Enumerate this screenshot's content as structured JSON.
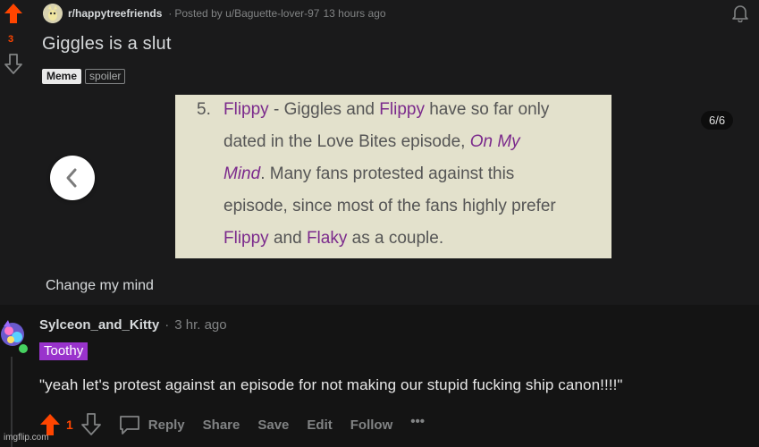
{
  "post": {
    "score": "3",
    "subreddit": "r/happytreefriends",
    "posted_by": "Posted by u/Baguette-lover-97",
    "time": "13 hours ago",
    "title": "Giggles is a slut",
    "flairs": [
      "Meme",
      "spoiler"
    ],
    "caption": "Change my mind",
    "gallery_counter": "6/6",
    "image_text": {
      "number": "5.",
      "line1": [
        "Flippy",
        " - Giggles and ",
        "Flippy",
        " have so far only"
      ],
      "line2": [
        "dated in the Love Bites episode, ",
        "On My"
      ],
      "line3": [
        "Mind",
        ". Many fans protested against this"
      ],
      "line4": "episode, since most of the fans highly prefer",
      "line5": [
        "Flippy",
        " and ",
        "Flaky",
        " as a couple."
      ]
    }
  },
  "comment": {
    "username": "Sylceon_and_Kitty",
    "time": "3 hr. ago",
    "user_flair": "Toothy",
    "body": "\"yeah let's protest against an episode for not making our stupid fucking ship canon!!!!\"",
    "score": "1",
    "actions": [
      "Reply",
      "Share",
      "Save",
      "Edit",
      "Follow",
      "•••"
    ]
  },
  "watermark": "imgflip.com",
  "colors": {
    "upvote": "#ff4500",
    "flair_purple": "#9933cc",
    "background": "#1a1a1b",
    "image_bg": "#e3e1cc"
  },
  "icons": [
    "upvote-arrow-icon",
    "downvote-arrow-icon",
    "bell-icon",
    "chevron-left-icon",
    "comment-bubble-icon",
    "subreddit-icon",
    "avatar-icon"
  ]
}
